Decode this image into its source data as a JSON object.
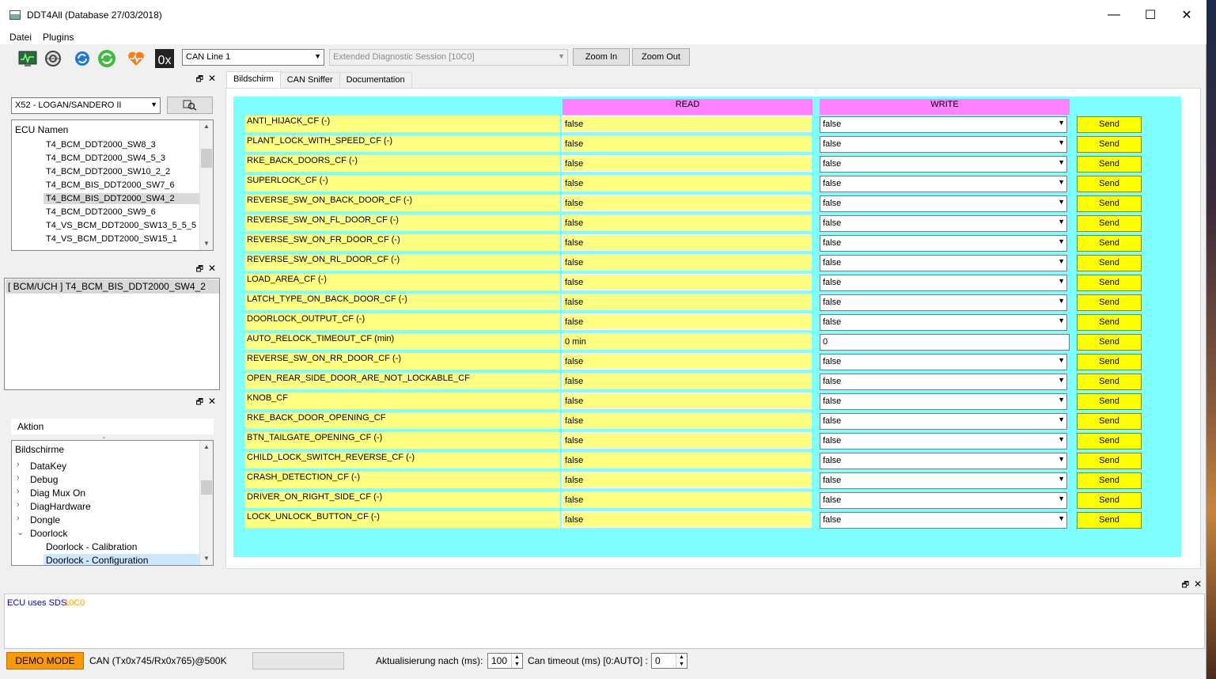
{
  "window": {
    "title": "DDT4All (Database 27/03/2018)",
    "min": "—",
    "max": "☐",
    "close": "✕"
  },
  "menu": [
    "Datei",
    "Plugins"
  ],
  "toolbar": {
    "icons": [
      "monitor-icon",
      "globe-gear-icon",
      "refresh-blue-icon",
      "refresh-green-icon",
      "heart-icon",
      "hex-icon"
    ],
    "hex_label": "0x",
    "can_line": "CAN Line 1",
    "session": "Extended Diagnostic Session [10C0]",
    "zoom_in": "Zoom In",
    "zoom_out": "Zoom Out"
  },
  "vehicle_dock": {
    "vehicle_select": "X52 - LOGAN/SANDERO II",
    "ecu_header": "ECU Namen",
    "ecus": [
      "T4_BCM_DDT2000_SW8_3",
      "T4_BCM_DDT2000_SW4_5_3",
      "T4_BCM_DDT2000_SW10_2_2",
      "T4_BCM_BIS_DDT2000_SW7_6",
      "T4_BCM_BIS_DDT2000_SW4_2",
      "T4_BCM_DDT2000_SW9_6",
      "T4_VS_BCM_DDT2000_SW13_5_5_5",
      "T4_VS_BCM_DDT2000_SW15_1"
    ],
    "selected_ecu_index": 4
  },
  "ecu_dock": {
    "current": "[ BCM/UCH ] T4_BCM_BIS_DDT2000_SW4_2"
  },
  "action_dock": {
    "action_header": "Aktion",
    "tree_header": "Bildschirme",
    "items": [
      {
        "label": "DataKey",
        "level": 1,
        "expander": "›"
      },
      {
        "label": "Debug",
        "level": 1,
        "expander": "›"
      },
      {
        "label": "Diag Mux On",
        "level": 1,
        "expander": "›"
      },
      {
        "label": "DiagHardware",
        "level": 1,
        "expander": "›"
      },
      {
        "label": "Dongle",
        "level": 1,
        "expander": "›"
      },
      {
        "label": "Doorlock",
        "level": 1,
        "expander": "⌄"
      },
      {
        "label": "Doorlock - Calibration",
        "level": 2,
        "expander": ""
      },
      {
        "label": "Doorlock - Configuration",
        "level": 2,
        "expander": ""
      }
    ],
    "selected_index": 7
  },
  "tabs": [
    "Bildschirm",
    "CAN Sniffer",
    "Documentation"
  ],
  "active_tab": 0,
  "screen": {
    "read_header": "READ",
    "write_header": "WRITE",
    "send_label": "Send",
    "rows": [
      {
        "name": "ANTI_HIJACK_CF (-)",
        "read": "false",
        "write": "false",
        "type": "combo"
      },
      {
        "name": "PLANT_LOCK_WITH_SPEED_CF (-)",
        "read": "false",
        "write": "false",
        "type": "combo"
      },
      {
        "name": "RKE_BACK_DOORS_CF (-)",
        "read": "false",
        "write": "false",
        "type": "combo"
      },
      {
        "name": "SUPERLOCK_CF (-)",
        "read": "false",
        "write": "false",
        "type": "combo"
      },
      {
        "name": "REVERSE_SW_ON_BACK_DOOR_CF (-)",
        "read": "false",
        "write": "false",
        "type": "combo"
      },
      {
        "name": "REVERSE_SW_ON_FL_DOOR_CF (-)",
        "read": "false",
        "write": "false",
        "type": "combo"
      },
      {
        "name": "REVERSE_SW_ON_FR_DOOR_CF (-)",
        "read": "false",
        "write": "false",
        "type": "combo"
      },
      {
        "name": "REVERSE_SW_ON_RL_DOOR_CF (-)",
        "read": "false",
        "write": "false",
        "type": "combo"
      },
      {
        "name": "LOAD_AREA_CF (-)",
        "read": "false",
        "write": "false",
        "type": "combo"
      },
      {
        "name": "LATCH_TYPE_ON_BACK_DOOR_CF (-)",
        "read": "false",
        "write": "false",
        "type": "combo"
      },
      {
        "name": "DOORLOCK_OUTPUT_CF (-)",
        "read": "false",
        "write": "false",
        "type": "combo"
      },
      {
        "name": "AUTO_RELOCK_TIMEOUT_CF (min)",
        "read": "0 min",
        "write": "0",
        "type": "edit"
      },
      {
        "name": "REVERSE_SW_ON_RR_DOOR_CF (-)",
        "read": "false",
        "write": "false",
        "type": "combo"
      },
      {
        "name": "OPEN_REAR_SIDE_DOOR_ARE_NOT_LOCKABLE_CF",
        "read": "false",
        "write": "false",
        "type": "combo"
      },
      {
        "name": "KNOB_CF",
        "read": "false",
        "write": "false",
        "type": "combo"
      },
      {
        "name": "RKE_BACK_DOOR_OPENING_CF",
        "read": "false",
        "write": "false",
        "type": "combo"
      },
      {
        "name": "BTN_TAILGATE_OPENING_CF (-)",
        "read": "false",
        "write": "false",
        "type": "combo"
      },
      {
        "name": "CHILD_LOCK_SWITCH_REVERSE_CF (-)",
        "read": "false",
        "write": "false",
        "type": "combo"
      },
      {
        "name": "CRASH_DETECTION_CF (-)",
        "read": "false",
        "write": "false",
        "type": "combo"
      },
      {
        "name": "DRIVER_ON_RIGHT_SIDE_CF (-)",
        "read": "false",
        "write": "false",
        "type": "combo"
      },
      {
        "name": "LOCK_UNLOCK_BUTTON_CF (-)",
        "read": "false",
        "write": "false",
        "type": "combo"
      }
    ]
  },
  "log": {
    "text": "ECU uses SDS",
    "code": "10C0",
    "text_color": "#0000cc",
    "code_color": "#ff9900"
  },
  "statusbar": {
    "demo": "DEMO MODE",
    "can": "CAN (Tx0x745/Rx0x765)@500K",
    "refresh_label": "Aktualisierung nach (ms):",
    "refresh_value": "100",
    "timeout_label": "Can timeout (ms) [0:AUTO] :",
    "timeout_value": "0"
  },
  "colors": {
    "screen_bg": "#80ffff",
    "header": "#ff80ff",
    "label_bg": "#ffff80",
    "send_bg": "#ffff00",
    "demo_bg": "#ff9900"
  }
}
